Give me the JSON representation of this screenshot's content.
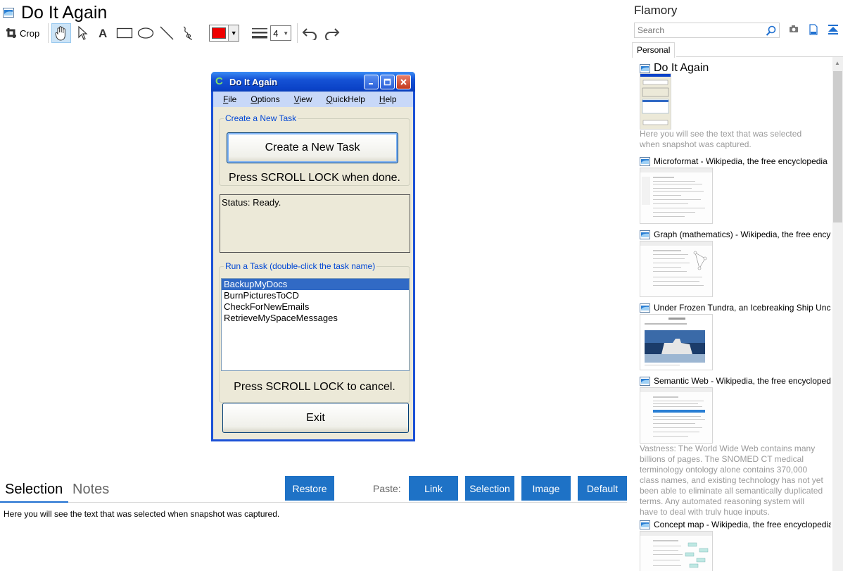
{
  "main": {
    "title": "Do It Again",
    "toolbar": {
      "crop_label": "Crop",
      "stroke_width": "4",
      "color": "#ee0000"
    }
  },
  "snapshot": {
    "window_title": "Do It Again",
    "menu": [
      "File",
      "Options",
      "View",
      "QuickHelp",
      "Help"
    ],
    "create_group_label": "Create a New Task",
    "create_button": "Create a New Task",
    "scroll_done": "Press SCROLL LOCK when done.",
    "status": "Status: Ready.",
    "run_group_label": "Run a Task (double-click the task name)",
    "tasks": [
      "BackupMyDocs",
      "BurnPicturesToCD",
      "CheckForNewEmails",
      "RetrieveMySpaceMessages"
    ],
    "selected_task": "BackupMyDocs",
    "scroll_cancel": "Press SCROLL LOCK to cancel.",
    "exit_button": "Exit"
  },
  "bottom": {
    "tabs": {
      "selection": "Selection",
      "notes": "Notes"
    },
    "restore": "Restore",
    "paste_label": "Paste:",
    "paste_buttons": {
      "link": "Link",
      "selection": "Selection",
      "image": "Image",
      "default": "Default"
    },
    "selection_text": "Here you will see the text that was selected when snapshot was captured."
  },
  "sidebar": {
    "title": "Flamory",
    "search_placeholder": "Search",
    "tab": "Personal",
    "entries": [
      {
        "title": "Do It Again",
        "desc": "Here you will see the text that was selected when snapshot was captured."
      },
      {
        "title": "Microformat - Wikipedia, the free encyclopedia"
      },
      {
        "title": "Graph (mathematics) - Wikipedia, the free ency"
      },
      {
        "title": "Under Frozen Tundra, an Icebreaking Ship Unco"
      },
      {
        "title": "Semantic Web - Wikipedia, the free encycloped",
        "desc": "Vastness: The World Wide Web contains many billions of pages. The SNOMED CT medical terminology ontology alone contains 370,000 class names, and existing technology has not yet been able to eliminate all semantically duplicated terms. Any automated reasoning system will have to deal with truly huge inputs."
      },
      {
        "title": "Concept map - Wikipedia, the free encyclopedia"
      }
    ]
  },
  "colors": {
    "accent": "#1e72c6",
    "xp_title": "#0b43c8",
    "selection": "#316ac5"
  }
}
